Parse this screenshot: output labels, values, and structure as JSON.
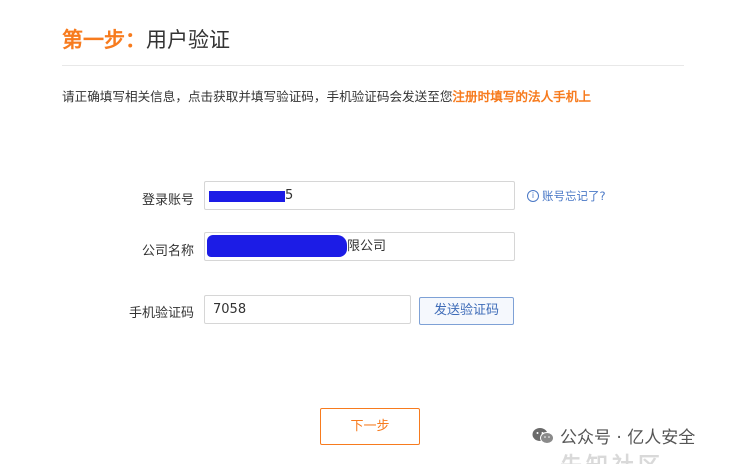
{
  "header": {
    "step_label": "第一步：",
    "step_title": "用户验证"
  },
  "instruction": {
    "text": "请正确填写相关信息，点击获取并填写验证码，手机验证码会发送至您",
    "highlight": "注册时填写的法人手机上"
  },
  "form": {
    "account": {
      "label": "登录账号",
      "value_visible": "5",
      "forgot_link": "账号忘记了?"
    },
    "company": {
      "label": "公司名称",
      "value_visible": "限公司"
    },
    "sms_code": {
      "label": "手机验证码",
      "value": "7058",
      "send_button": "发送验证码"
    }
  },
  "actions": {
    "next_button": "下一步"
  },
  "watermark": {
    "text": "公众号 · 亿人安全",
    "ghost_text": "先知社区"
  },
  "colors": {
    "accent": "#f77b1e",
    "link": "#4a78c6",
    "redaction": "#1c1ce6"
  }
}
